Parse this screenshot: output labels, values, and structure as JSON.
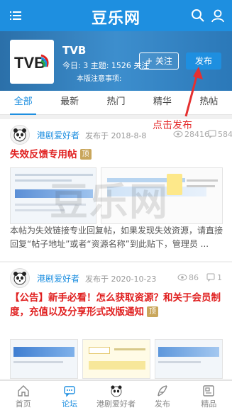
{
  "topbar": {
    "brand": "豆乐网"
  },
  "forum": {
    "logo_text": "TVB",
    "title": "TVB",
    "stats": "今日: 3  主题: 1526  关注",
    "note": "本版注意事项:",
    "follow_label": "+ 关注",
    "publish_label": "发布"
  },
  "tabs": [
    {
      "label": "全部"
    },
    {
      "label": "最新"
    },
    {
      "label": "热门"
    },
    {
      "label": "精华"
    },
    {
      "label": "热帖"
    }
  ],
  "annotation": {
    "label": "点击发布",
    "color": "#e53030"
  },
  "posts": [
    {
      "author": "港剧爱好者",
      "posted": "发布于 2018-8-8",
      "views": "28416",
      "comments": "584",
      "title": "失效反馈专用帖",
      "badge": "顶",
      "excerpt": "本帖为失效链接专业回复帖，如果发现失效资源，请直接回复“帖子地址”或者“资源名称”到此贴下，管理员 ..."
    },
    {
      "author": "港剧爱好者",
      "posted": "发布于 2020-10-23",
      "views": "86",
      "comments": "1",
      "title": "【公告】新手必看！怎么获取资源？和关于会员制度，充值以及分享形式改版通知",
      "badge": "顶"
    }
  ],
  "watermark": "豆乐网",
  "bottomnav": [
    {
      "label": "首页",
      "icon": "home-icon"
    },
    {
      "label": "论坛",
      "icon": "forum-icon"
    },
    {
      "label": "港剧爱好者",
      "icon": "avatar"
    },
    {
      "label": "发布",
      "icon": "feather-icon"
    },
    {
      "label": "精品",
      "icon": "news-icon"
    }
  ],
  "colors": {
    "primary": "#1e8fe0",
    "title_red": "#e02020",
    "badge": "#c9a65b"
  }
}
